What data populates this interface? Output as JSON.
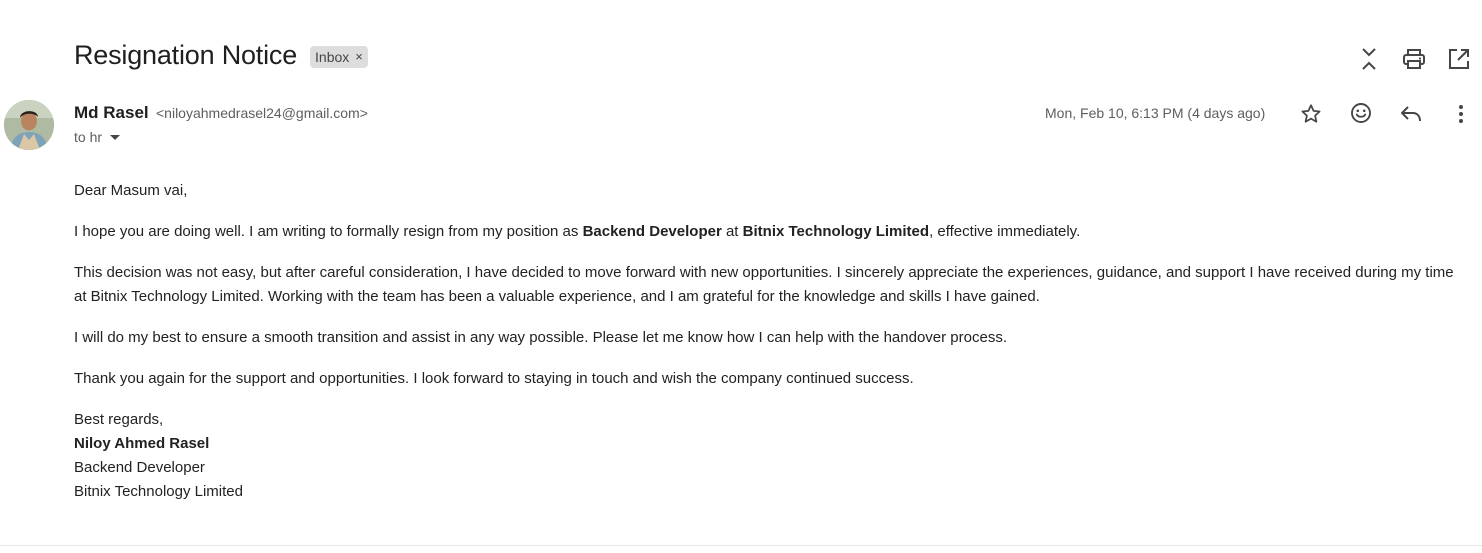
{
  "email": {
    "subject": "Resignation Notice",
    "label": "Inbox",
    "label_remove": "×",
    "sender_name": "Md Rasel",
    "sender_email": "<niloyahmedrasel24@gmail.com>",
    "to_line": "to hr",
    "date": "Mon, Feb 10, 6:13 PM (4 days ago)"
  },
  "toolbar": {
    "icons": [
      "collapse-all-icon",
      "print-icon",
      "open-in-new-window-icon"
    ]
  },
  "actions": {
    "icons": [
      "star-icon",
      "emoji-react-icon",
      "reply-icon",
      "more-vert-icon"
    ]
  },
  "body": {
    "greeting": "Dear Masum vai,",
    "p1_a": "I hope you are doing well. I am writing to formally resign from my position as ",
    "p1_role": "Backend Developer",
    "p1_b": " at ",
    "p1_company": "Bitnix Technology Limited",
    "p1_c": ", effective immediately.",
    "p2": "This decision was not easy, but after careful consideration, I have decided to move forward with new opportunities. I sincerely appreciate the experiences, guidance, and support I have received during my time at Bitnix Technology Limited. Working with the team has been a valuable experience, and I am grateful for the knowledge and skills I have gained.",
    "p3": "I will do my best to ensure a smooth transition and assist in any way possible. Please let me know how I can help with the handover process.",
    "p4": "Thank you again for the support and opportunities. I look forward to staying in touch and wish the company continued success.",
    "closing": "Best regards,",
    "sig_name": "Niloy Ahmed Rasel",
    "sig_title": "Backend Developer",
    "sig_company": "Bitnix Technology Limited"
  }
}
